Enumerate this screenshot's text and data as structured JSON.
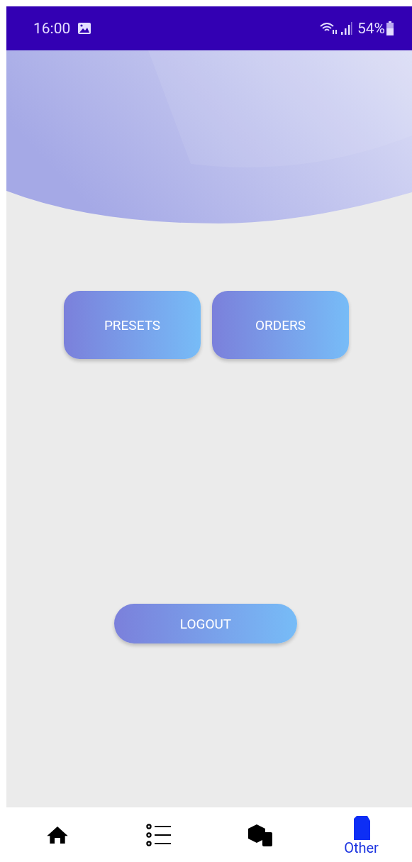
{
  "status_bar": {
    "time": "16:00",
    "battery": "54%"
  },
  "menu_buttons": [
    "PRESETS",
    "ORDERS"
  ],
  "logout_button": "LOGOUT",
  "bottom_nav": [
    {
      "kind": "home",
      "selected": false
    },
    {
      "kind": "list",
      "selected": false
    },
    {
      "kind": "boxes",
      "selected": false
    },
    {
      "kind": "document",
      "label": "Other",
      "selected": true
    }
  ]
}
